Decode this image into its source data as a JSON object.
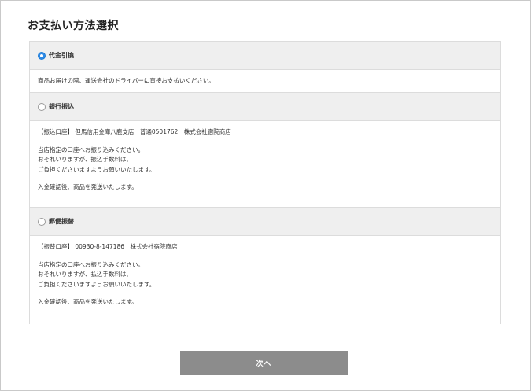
{
  "page": {
    "title": "お支払い方法選択"
  },
  "methods": [
    {
      "label": "代金引換",
      "selected": true,
      "body": {
        "line1": "商品お届けの際、運送会社のドライバーに直接お支払いください。"
      }
    },
    {
      "label": "銀行振込",
      "selected": false,
      "body": {
        "account": "【振込口座】 但馬信用金庫八鹿支店　普通0501762　株式会社宿院商店",
        "line1": "当店指定の口座へお振り込みください。",
        "line2": "おそれいりますが、振込手数料は、",
        "line3": "ご負担くださいますようお願いいたします。",
        "line4": "入金確認後、商品を発送いたします。"
      }
    },
    {
      "label": "郵便振替",
      "selected": false,
      "body": {
        "account": "【振替口座】 00930-8-147186　株式会社宿院商店",
        "line1": "当店指定の口座へお振り込みください。",
        "line2": "おそれいりますが、払込手数料は、",
        "line3": "ご負担くださいますようお願いいたします。",
        "line4": "入金確認後、商品を発送いたします。"
      }
    }
  ],
  "actions": {
    "next_label": "次へ"
  },
  "colors": {
    "radio_selected": "#2f8ae6",
    "header_bg": "#efefef",
    "button_bg": "#8c8c8c"
  }
}
